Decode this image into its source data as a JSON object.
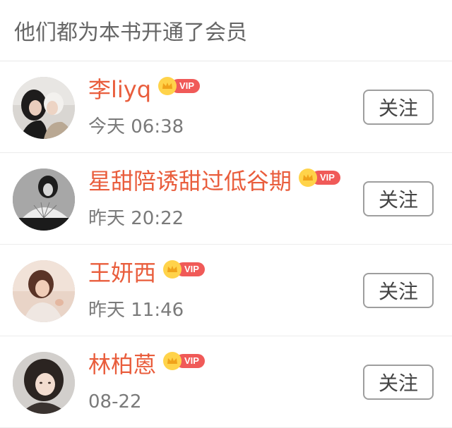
{
  "header": {
    "title": "他们都为本书开通了会员"
  },
  "colors": {
    "username": "#e95d3c",
    "vip_badge": "#f05a58",
    "vip_crown": "#ffd34a"
  },
  "vip_label": "VIP",
  "members": [
    {
      "name": "李liyq",
      "time": "今天 06:38",
      "follow_label": "关注",
      "vip": true
    },
    {
      "name": "星甜陪诱甜过低谷期",
      "time": "昨天 20:22",
      "follow_label": "关注",
      "vip": true
    },
    {
      "name": "王妍西",
      "time": "昨天 11:46",
      "follow_label": "关注",
      "vip": true
    },
    {
      "name": "林柏蒽",
      "time": "08-22",
      "follow_label": "关注",
      "vip": true
    }
  ]
}
